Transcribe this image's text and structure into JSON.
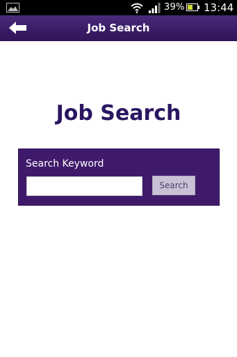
{
  "status_bar": {
    "battery_percent": "39%",
    "time": "13:44",
    "icons": [
      "gallery-icon",
      "wifi-icon",
      "signal-icon",
      "battery-icon"
    ]
  },
  "header": {
    "title": "Job Search",
    "back_icon": "arrow-left-icon"
  },
  "main": {
    "title": "Job Search"
  },
  "search": {
    "label": "Search Keyword",
    "input_value": "",
    "button_label": "Search"
  },
  "colors": {
    "header_bg": "#3a1c66",
    "panel_bg": "#3f1a6b",
    "title_color": "#2a1660",
    "button_bg": "#c9c2d6"
  }
}
